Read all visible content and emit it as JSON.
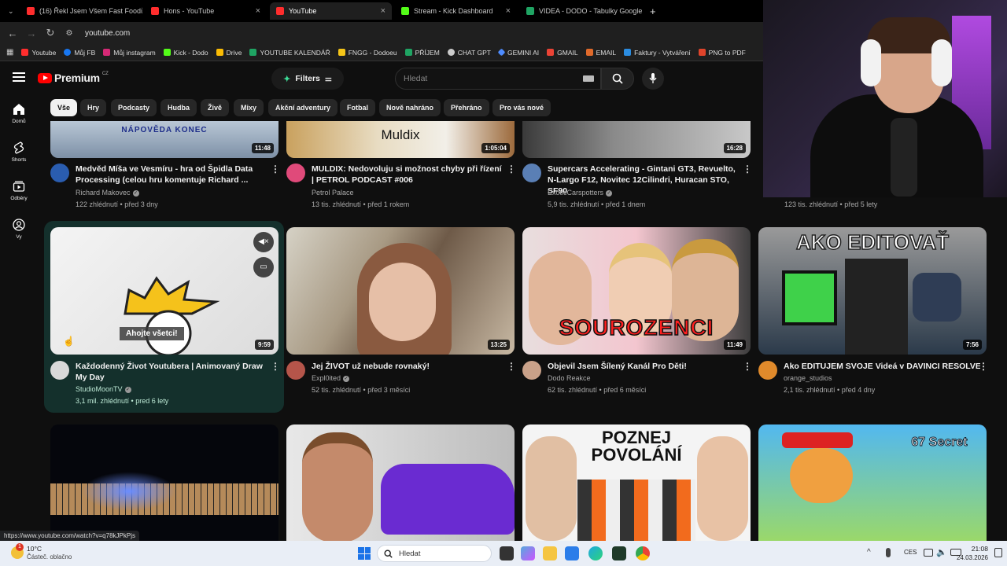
{
  "browser": {
    "tabs": [
      {
        "label": "(16) Řekl Jsem Všem Fast Foodů",
        "color": "#ff2d2d"
      },
      {
        "label": "Hons - YouTube",
        "color": "#ff2d2d"
      },
      {
        "label": "YouTube",
        "color": "#ff2d2d",
        "active": true
      },
      {
        "label": "Stream - Kick Dashboard",
        "color": "#53fc18"
      },
      {
        "label": "VIDEA - DODO - Tabulky Google",
        "color": "#1fa463"
      }
    ],
    "url": "youtube.com",
    "bookmarks": [
      {
        "label": "Youtube",
        "color": "#ff2d2d"
      },
      {
        "label": "Můj FB",
        "color": "#1877f2"
      },
      {
        "label": "Můj instagram",
        "color": "#d62976"
      },
      {
        "label": "Kick - Dodo",
        "color": "#53fc18"
      },
      {
        "label": "Drive",
        "color": "#fbbc04"
      },
      {
        "label": "YOUTUBE KALENDÁŘ",
        "color": "#1fa463"
      },
      {
        "label": "FNGG - Dodoeu",
        "color": "#f5c518"
      },
      {
        "label": "PŘÍJEM",
        "color": "#1fa463"
      },
      {
        "label": "CHAT GPT",
        "color": "#cccccc"
      },
      {
        "label": "GEMINI AI",
        "color": "#4e8cff"
      },
      {
        "label": "GMAIL",
        "color": "#ea4335"
      },
      {
        "label": "EMAIL",
        "color": "#e06a2b"
      },
      {
        "label": "Faktury - Vytváření",
        "color": "#2b8ce0"
      },
      {
        "label": "PNG to PDF",
        "color": "#e0442b"
      }
    ]
  },
  "youtube": {
    "logo_text": "Premium",
    "logo_region": "CZ",
    "filters_label": "Filters",
    "search_placeholder": "Hledat",
    "chips": [
      "Vše",
      "Hry",
      "Podcasty",
      "Hudba",
      "Živě",
      "Mixy",
      "Akční adventury",
      "Fotbal",
      "Nově nahráno",
      "Přehráno",
      "Pro vás nové"
    ],
    "sidebar": [
      {
        "label": "Domů",
        "icon": "home-icon"
      },
      {
        "label": "Shorts",
        "icon": "shorts-icon"
      },
      {
        "label": "Odběry",
        "icon": "subscriptions-icon"
      },
      {
        "label": "Vy",
        "icon": "user-icon"
      }
    ],
    "row1": [
      {
        "title": "Medvěd Míša ve Vesmíru - hra od Špidla Data Processing (celou hru komentuje Richard ...",
        "channel": "Richard Makovec",
        "verified": true,
        "stats": "122 zhlédnutí • před 3 dny",
        "duration": "11:48",
        "thumb_text": "NÁPOVĚDA KONEC"
      },
      {
        "title": "MULDIX: Nedovoluju si možnost chyby při řízení | PETROL PODCAST #006",
        "channel": "Petrol Palace",
        "verified": false,
        "stats": "13 tis. zhlédnutí • před 1 rokem",
        "duration": "1:05:04",
        "thumb_text": "Muldix"
      },
      {
        "title": "Supercars Accelerating - Gintani GT3, Revuelto, N-Largo F12, Novitec 12Cilindri, Huracan STO, SF90",
        "channel": "ExoticCarspotters",
        "verified": true,
        "stats": "5,9 tis. zhlédnutí • před 1 dnem",
        "duration": "16:28"
      },
      {
        "stats": "123 tis. zhlédnutí • před 5 lety"
      }
    ],
    "row2": [
      {
        "title": "Každodenný Život Youtubera | Animovaný Draw My Day",
        "channel": "StudioMoonTV",
        "verified": true,
        "stats": "3,1 mil. zhlédnutí • pred 6 lety",
        "duration": "9:59",
        "caption": "Ahojte všetci!"
      },
      {
        "title": "Jej ŽIVOT už nebude rovnaký!",
        "channel": "Expl0ited",
        "verified": true,
        "stats": "52 tis. zhlédnutí • před 3 měsíci",
        "duration": "13:25"
      },
      {
        "title": "Objevil Jsem Šílený Kanál Pro Děti!",
        "channel": "Dodo Reakce",
        "verified": false,
        "stats": "62 tis. zhlédnutí • před 6 měsíci",
        "duration": "11:49",
        "thumb_text": "SOUROZENCI"
      },
      {
        "title": "Ako EDITUJEM SVOJE Videá v DAVINCI RESOLVE...",
        "channel": "orange_studios",
        "verified": false,
        "stats": "2,1 tis. zhlédnutí • před 4 dny",
        "duration": "7:56",
        "thumb_text": "AKO EDITOVAŤ"
      }
    ],
    "row3_thumb_texts": [
      "POZNEJ POVOLÁNÍ",
      "67 Secret"
    ],
    "status_url": "https://www.youtube.com/watch?v=q78kJPkPjs"
  },
  "taskbar": {
    "weather_temp": "10°C",
    "weather_desc": "Částeč. oblačno",
    "search_placeholder": "Hledat",
    "language": "CES",
    "time": "21:08",
    "date": "24.03.2026",
    "notification_count": "1"
  }
}
